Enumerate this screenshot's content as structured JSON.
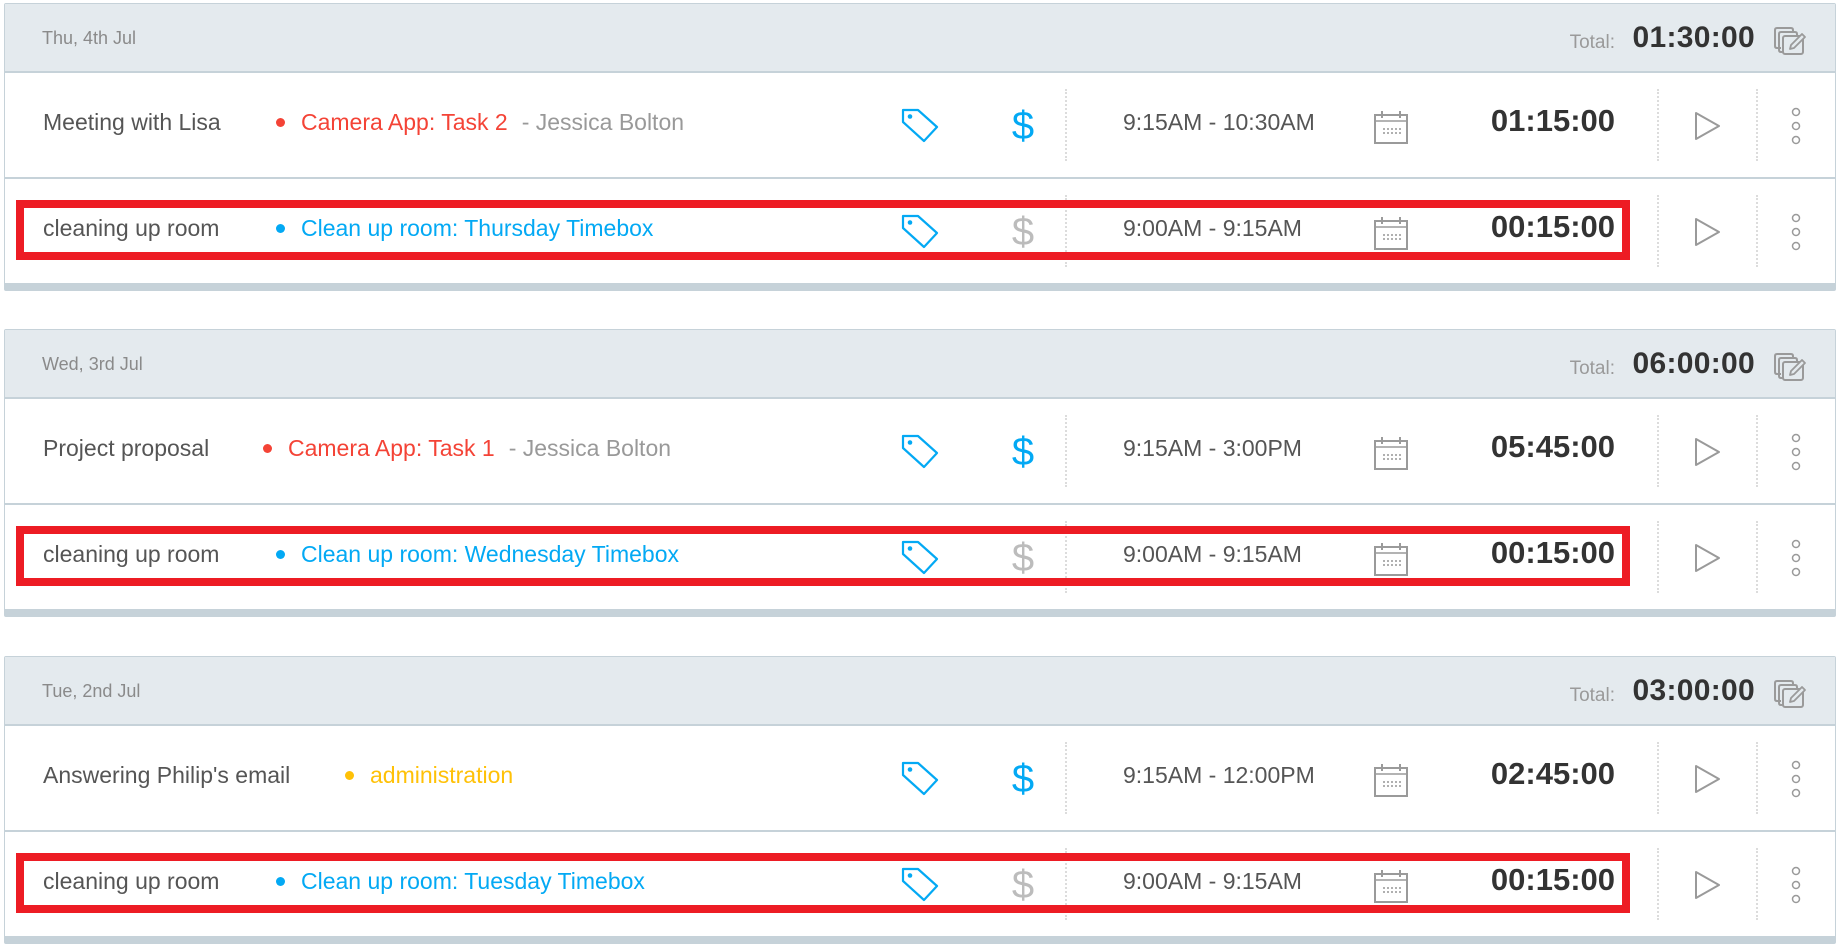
{
  "colors": {
    "highlight": "#ed1c24",
    "billable_active": "#03a9f4",
    "billable_inactive": "#b5b5b5",
    "tag": "#03a9f4"
  },
  "days": [
    {
      "date": "Thu, 4th Jul",
      "total_label": "Total:",
      "total": "01:30:00",
      "entries": [
        {
          "description": "Meeting with Lisa",
          "project": "Camera App: Task 2",
          "project_color": "#f44336",
          "client": "- Jessica Bolton",
          "billable": true,
          "time_range": "9:15AM - 10:30AM",
          "duration": "01:15:00",
          "highlighted": false
        },
        {
          "description": "cleaning up room",
          "project": "Clean up room: Thursday Timebox",
          "project_color": "#03a9f4",
          "client": "",
          "billable": false,
          "time_range": "9:00AM - 9:15AM",
          "duration": "00:15:00",
          "highlighted": true
        }
      ]
    },
    {
      "date": "Wed, 3rd Jul",
      "total_label": "Total:",
      "total": "06:00:00",
      "entries": [
        {
          "description": "Project proposal",
          "project": "Camera App: Task 1",
          "project_color": "#f44336",
          "client": "- Jessica Bolton",
          "billable": true,
          "time_range": "9:15AM - 3:00PM",
          "duration": "05:45:00",
          "highlighted": false
        },
        {
          "description": "cleaning up room",
          "project": "Clean up room: Wednesday Timebox",
          "project_color": "#03a9f4",
          "client": "",
          "billable": false,
          "time_range": "9:00AM - 9:15AM",
          "duration": "00:15:00",
          "highlighted": true
        }
      ]
    },
    {
      "date": "Tue, 2nd Jul",
      "total_label": "Total:",
      "total": "03:00:00",
      "entries": [
        {
          "description": "Answering Philip's email",
          "project": "administration",
          "project_color": "#ffc107",
          "client": "",
          "billable": true,
          "time_range": "9:15AM - 12:00PM",
          "duration": "02:45:00",
          "highlighted": false
        },
        {
          "description": "cleaning up room",
          "project": "Clean up room: Tuesday Timebox",
          "project_color": "#03a9f4",
          "client": "",
          "billable": false,
          "time_range": "9:00AM - 9:15AM",
          "duration": "00:15:00",
          "highlighted": true
        }
      ]
    }
  ]
}
